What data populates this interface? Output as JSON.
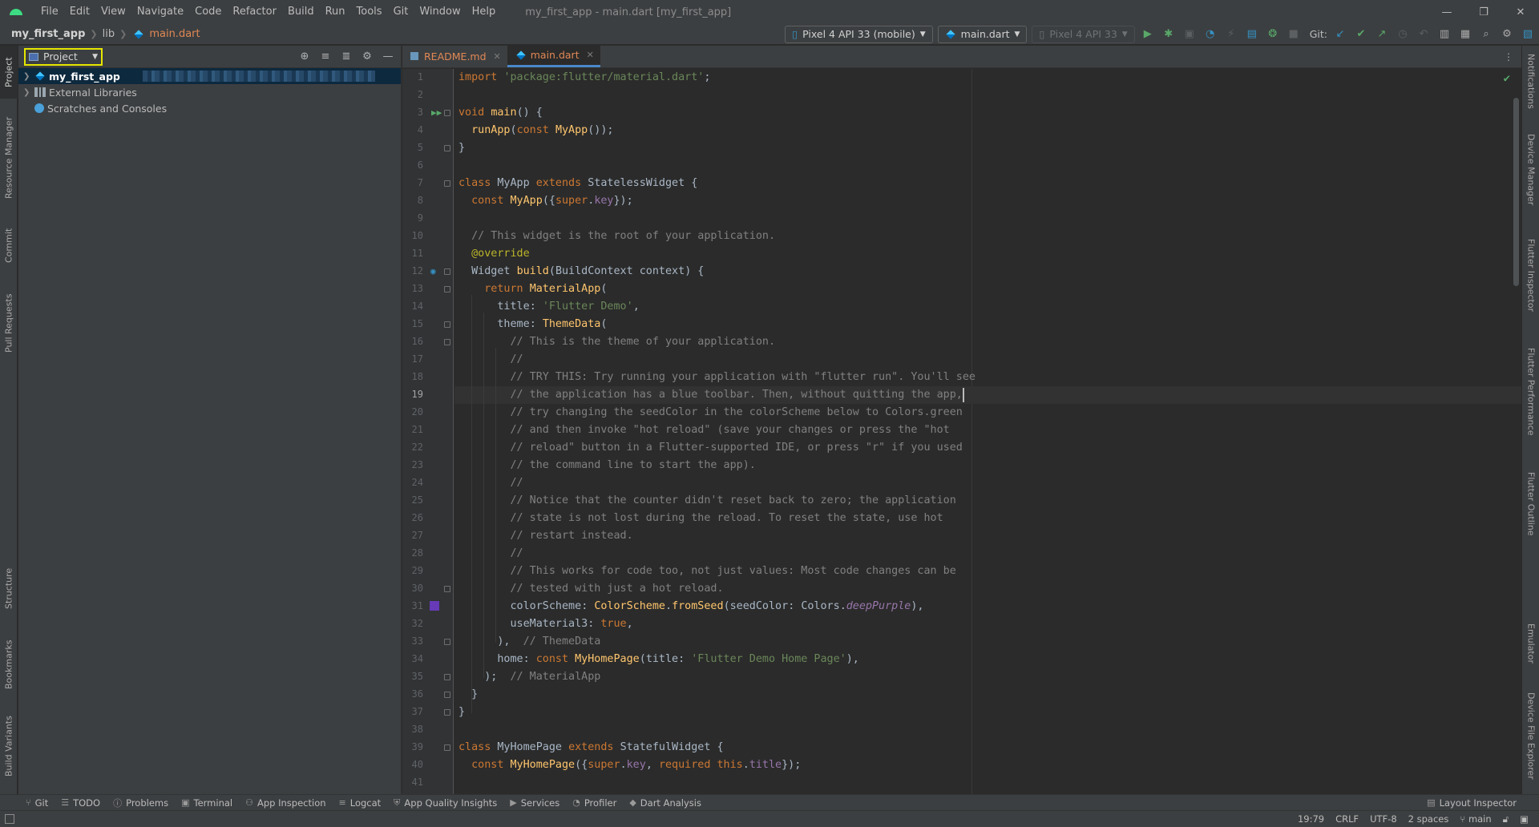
{
  "window": {
    "title": "my_first_app - main.dart [my_first_app]",
    "controls": [
      "—",
      "❐",
      "✕"
    ]
  },
  "menu": [
    "File",
    "Edit",
    "View",
    "Navigate",
    "Code",
    "Refactor",
    "Build",
    "Run",
    "Tools",
    "Git",
    "Window",
    "Help"
  ],
  "breadcrumb": {
    "project": "my_first_app",
    "folder": "lib",
    "file": "main.dart"
  },
  "toolbar": {
    "device": "Pixel 4 API 33 (mobile)",
    "run_config": "main.dart",
    "device_disabled": "Pixel 4 API 33",
    "git_label": "Git:"
  },
  "left_tabs": [
    "Project",
    "Resource Manager",
    "Commit",
    "Pull Requests",
    "Structure",
    "Bookmarks",
    "Build Variants"
  ],
  "right_tabs": [
    "Notifications",
    "Device Manager",
    "Flutter Inspector",
    "Flutter Performance",
    "Flutter Outline",
    "Emulator",
    "Device File Explorer"
  ],
  "project_panel": {
    "view_selector": "Project",
    "tree": [
      {
        "label": "my_first_app",
        "selected": true
      },
      {
        "label": "External Libraries",
        "selected": false
      },
      {
        "label": "Scratches and Consoles",
        "selected": false
      }
    ]
  },
  "editor_tabs": [
    {
      "label": "README.md",
      "active": false
    },
    {
      "label": "main.dart",
      "active": true
    }
  ],
  "code": {
    "current_line": 19,
    "lines": [
      "import 'package:flutter/material.dart';",
      "",
      "void main() {",
      "  runApp(const MyApp());",
      "}",
      "",
      "class MyApp extends StatelessWidget {",
      "  const MyApp({super.key});",
      "",
      "  // This widget is the root of your application.",
      "  @override",
      "  Widget build(BuildContext context) {",
      "    return MaterialApp(",
      "      title: 'Flutter Demo',",
      "      theme: ThemeData(",
      "        // This is the theme of your application.",
      "        //",
      "        // TRY THIS: Try running your application with \"flutter run\". You'll see",
      "        // the application has a blue toolbar. Then, without quitting the app,",
      "        // try changing the seedColor in the colorScheme below to Colors.green",
      "        // and then invoke \"hot reload\" (save your changes or press the \"hot",
      "        // reload\" button in a Flutter-supported IDE, or press \"r\" if you used",
      "        // the command line to start the app).",
      "        //",
      "        // Notice that the counter didn't reset back to zero; the application",
      "        // state is not lost during the reload. To reset the state, use hot",
      "        // restart instead.",
      "        //",
      "        // This works for code too, not just values: Most code changes can be",
      "        // tested with just a hot reload.",
      "        colorScheme: ColorScheme.fromSeed(seedColor: Colors.deepPurple),",
      "        useMaterial3: true,",
      "      ),  // ThemeData",
      "      home: const MyHomePage(title: 'Flutter Demo Home Page'),",
      "    );  // MaterialApp",
      "  }",
      "}",
      "",
      "class MyHomePage extends StatefulWidget {",
      "  const MyHomePage({super.key, required this.title});",
      ""
    ]
  },
  "bottom_tools": [
    "Git",
    "TODO",
    "Problems",
    "Terminal",
    "App Inspection",
    "Logcat",
    "App Quality Insights",
    "Services",
    "Profiler",
    "Dart Analysis"
  ],
  "layout_inspector": "Layout Inspector",
  "status": {
    "position": "19:79",
    "line_sep": "CRLF",
    "encoding": "UTF-8",
    "indent": "2 spaces",
    "branch": "main"
  },
  "colors": {
    "accent": "#4a88c7",
    "seed_swatch": "#673ab7",
    "highlight_box": "#e6e600"
  }
}
